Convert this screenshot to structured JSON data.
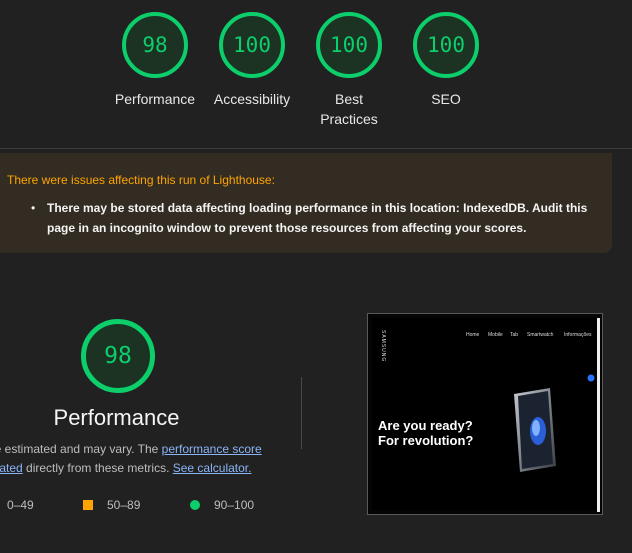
{
  "summary": {
    "gauges": [
      {
        "score": "98",
        "label": "Performance"
      },
      {
        "score": "100",
        "label": "Accessibility"
      },
      {
        "score": "100",
        "label": "Best\nPractices"
      },
      {
        "score": "100",
        "label": "SEO"
      }
    ]
  },
  "warning": {
    "title": "There were issues affecting this run of Lighthouse:",
    "bullet": "•",
    "item": "There may be stored data affecting loading performance in this location: IndexedDB. Audit this page in an incognito window to prevent those resources from affecting your scores."
  },
  "performance": {
    "score": "98",
    "title": "Performance",
    "desc_line1_text": "are estimated and may vary. The ",
    "desc_link1": "performance score",
    "desc_line2_link": "culated",
    "desc_line2_text": " directly from these metrics. ",
    "desc_link2": "See calculator.",
    "legend": {
      "fail": "0–49",
      "average": "50–89",
      "pass": "90–100"
    }
  },
  "screenshot": {
    "logo": "SAMSUNG",
    "nav": [
      "Home",
      "Mobile",
      "Tab",
      "Smartwatch",
      "Informações"
    ],
    "hero_line1": "Are you ready?",
    "hero_line2": "For revolution?"
  },
  "colors": {
    "pass": "#0cce6b",
    "average": "#ffa400",
    "link": "#8ab4f8",
    "background": "#212121"
  }
}
